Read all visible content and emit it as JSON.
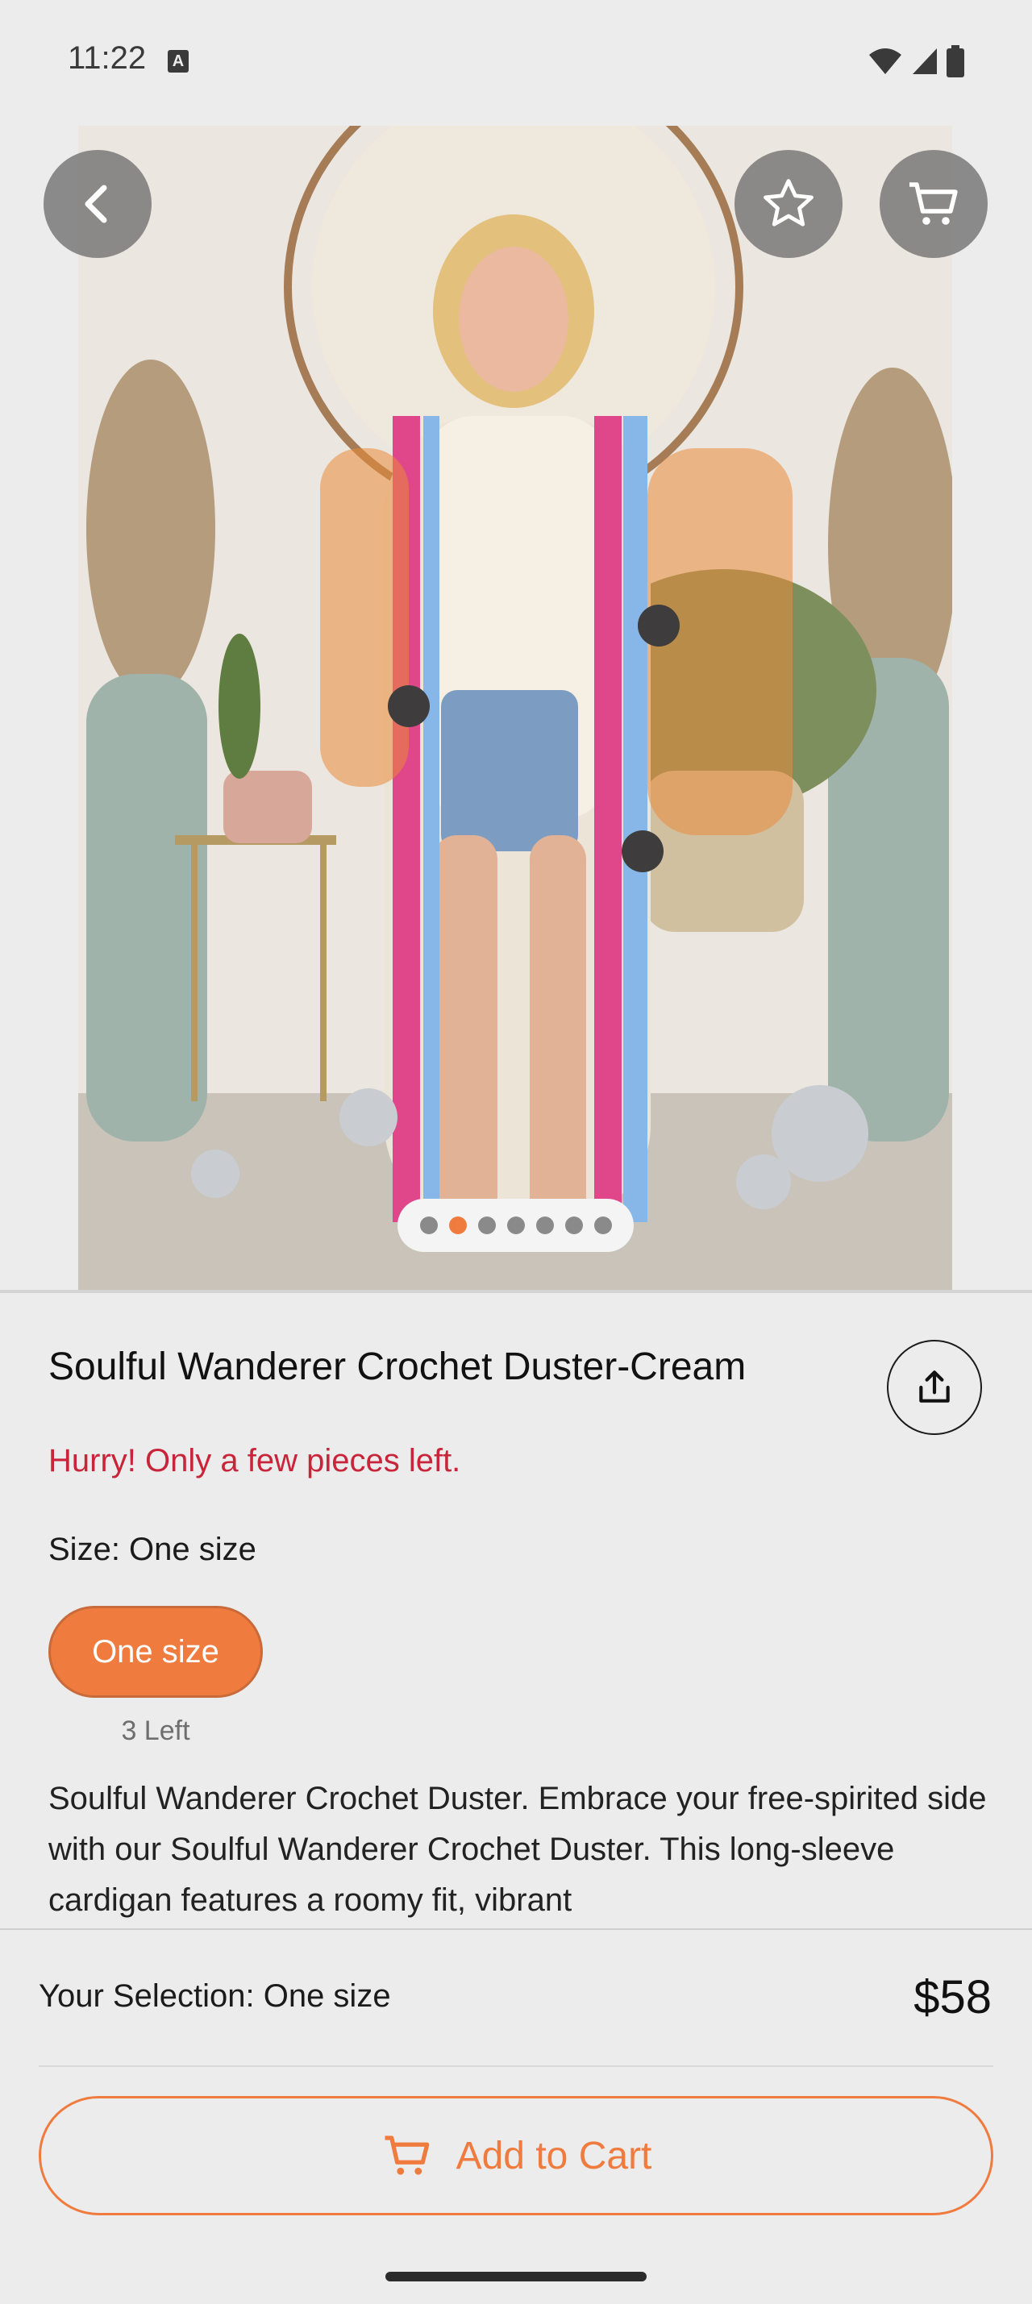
{
  "status_bar": {
    "time": "11:22",
    "notif": "A"
  },
  "product": {
    "title": "Soulful Wanderer Crochet Duster-Cream",
    "stock_warning": "Hurry! Only a few pieces left.",
    "size_label": "Size: One size",
    "size_option": "One size",
    "size_stock": "3 Left",
    "description": "Soulful Wanderer Crochet Duster. Embrace your free-spirited side with our Soulful Wanderer Crochet Duster. This long-sleeve cardigan features a roomy fit, vibrant"
  },
  "gallery": {
    "total_images": 7,
    "current_index": 1
  },
  "bottom_bar": {
    "selection": "Your Selection: One size",
    "price": "$58",
    "add_to_cart": "Add to Cart"
  },
  "colors": {
    "accent": "#ef7b3e",
    "warning": "#c8243a"
  },
  "icons": [
    "back-icon",
    "star-icon",
    "cart-icon",
    "share-icon",
    "wifi-icon",
    "signal-icon",
    "battery-icon"
  ]
}
